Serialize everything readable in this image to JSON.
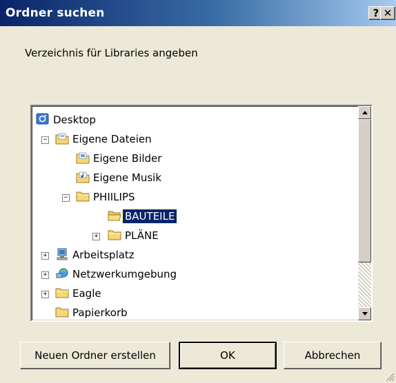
{
  "window": {
    "title": "Ordner suchen",
    "help_glyph": "?",
    "close_glyph": "✕"
  },
  "instruction": "Verzeichnis für Libraries angeben",
  "tree": {
    "items": [
      {
        "label": "Desktop",
        "icon": "desktop-icon",
        "expander": ""
      },
      {
        "label": "Eigene Dateien",
        "icon": "folder-documents-icon",
        "expander": "−"
      },
      {
        "label": "Eigene Bilder",
        "icon": "folder-pictures-icon",
        "expander": ""
      },
      {
        "label": "Eigene Musik",
        "icon": "folder-music-icon",
        "expander": ""
      },
      {
        "label": "PHIILIPS",
        "icon": "folder-icon",
        "expander": "−"
      },
      {
        "label": "BAUTEILE",
        "icon": "folder-icon",
        "expander": "",
        "selected": true
      },
      {
        "label": "PLÄNE",
        "icon": "folder-icon",
        "expander": "+"
      },
      {
        "label": "Arbeitsplatz",
        "icon": "computer-icon",
        "expander": "+"
      },
      {
        "label": "Netzwerkumgebung",
        "icon": "network-icon",
        "expander": "+"
      },
      {
        "label": "Eagle",
        "icon": "folder-icon",
        "expander": "+"
      },
      {
        "label": "Papierkorb",
        "icon": "folder-icon",
        "expander": ""
      }
    ]
  },
  "buttons": {
    "new_folder": "Neuen Ordner erstellen",
    "ok": "OK",
    "cancel": "Abbrechen"
  },
  "colors": {
    "selection": "#0a246a",
    "dialog_bg": "#ece9d8"
  }
}
